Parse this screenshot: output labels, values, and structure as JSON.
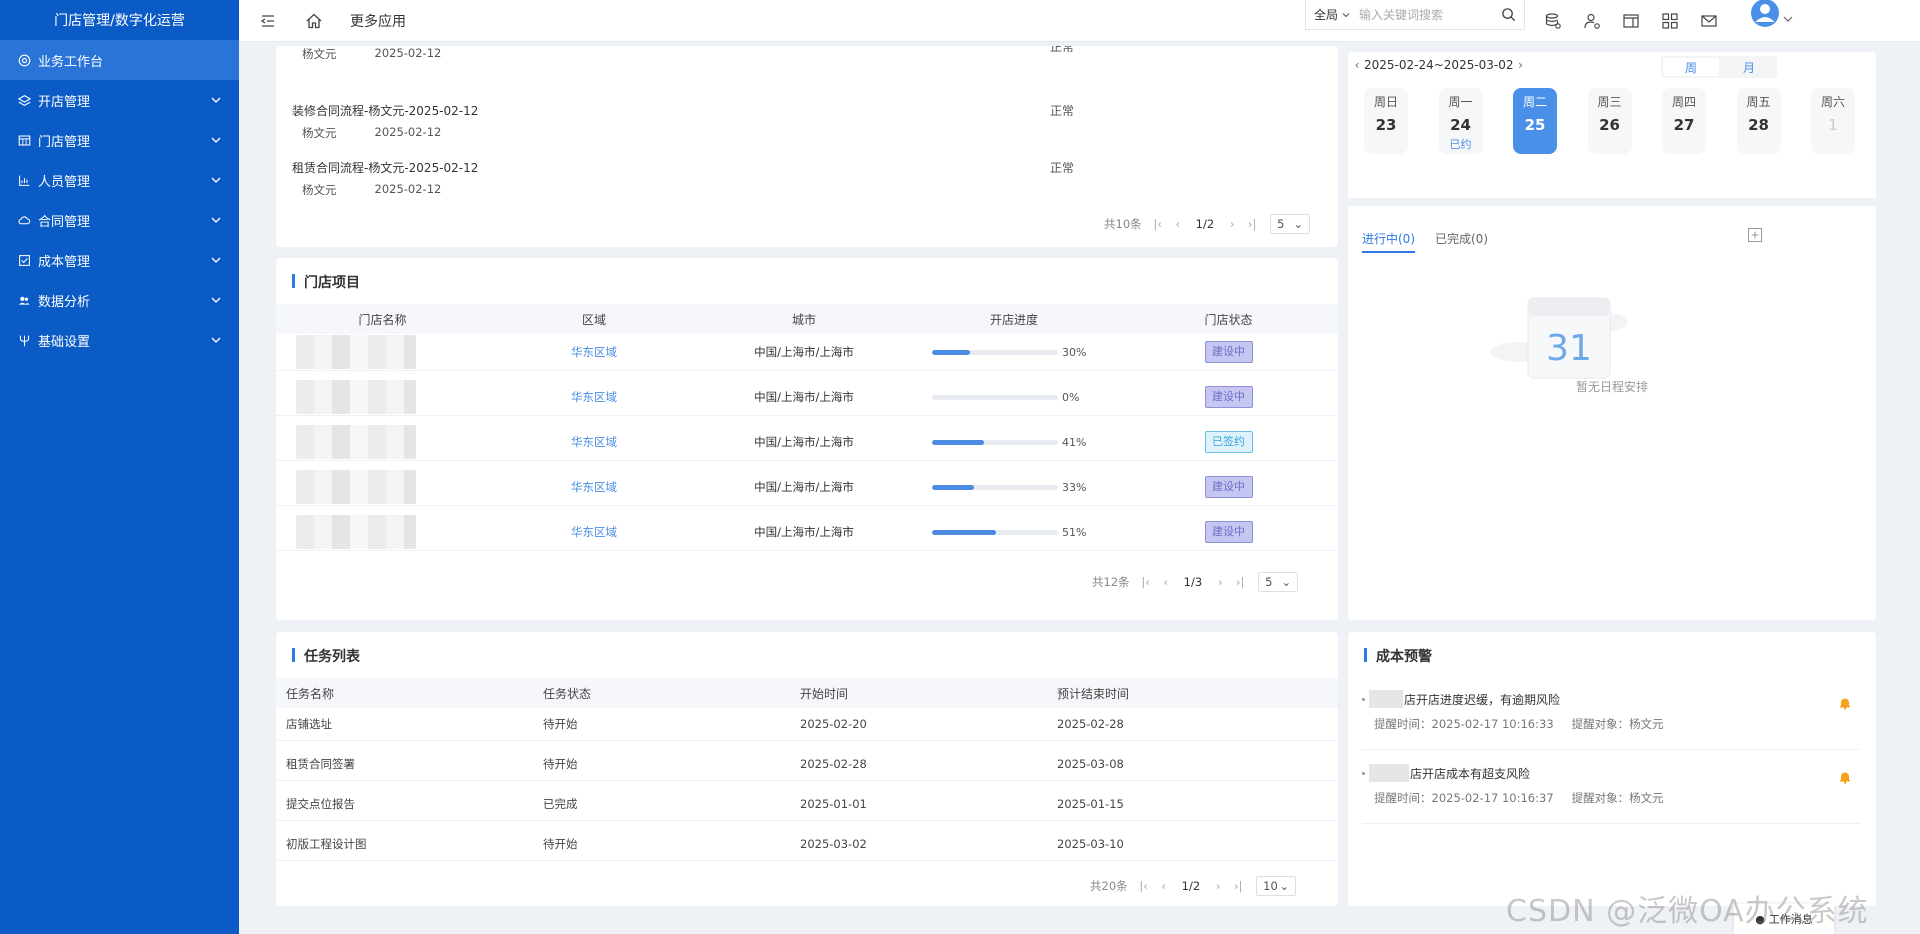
{
  "sidebar": {
    "brand": "门店管理/数字化运营",
    "items": [
      {
        "label": "业务工作台",
        "icon": "at-icon"
      },
      {
        "label": "开店管理",
        "icon": "layers-icon"
      },
      {
        "label": "门店管理",
        "icon": "table-icon"
      },
      {
        "label": "人员管理",
        "icon": "bar-chart-icon"
      },
      {
        "label": "合同管理",
        "icon": "cloud-icon"
      },
      {
        "label": "成本管理",
        "icon": "checkbox-icon"
      },
      {
        "label": "数据分析",
        "icon": "users-icon"
      },
      {
        "label": "基础设置",
        "icon": "fork-icon"
      }
    ]
  },
  "topbar": {
    "more_apps": "更多应用",
    "search_scope": "全局",
    "search_placeholder": "输入关键词搜索"
  },
  "processes": {
    "items": [
      {
        "title": "装修合同流程-杨文元-2025-02-12",
        "person": "杨文元",
        "date": "2025-02-12",
        "status": "正常"
      },
      {
        "title": "租赁合同流程-杨文元-2025-02-12",
        "person": "杨文元",
        "date": "2025-02-12",
        "status": "正常"
      }
    ],
    "partial_person": "杨文元",
    "partial_date": "2025-02-12",
    "partial_status": "正常",
    "total": "共10条",
    "page": "1/2",
    "size": "5"
  },
  "stores": {
    "title": "门店项目",
    "headers": [
      "门店名称",
      "区域",
      "城市",
      "开店进度",
      "门店状态"
    ],
    "rows": [
      {
        "region": "华东区域",
        "city": "中国/上海市/上海市",
        "progress": 30,
        "progress_text": "30%",
        "status": "建设中",
        "status_type": "building"
      },
      {
        "region": "华东区域",
        "city": "中国/上海市/上海市",
        "progress": 0,
        "progress_text": "0%",
        "status": "建设中",
        "status_type": "building"
      },
      {
        "region": "华东区域",
        "city": "中国/上海市/上海市",
        "progress": 41,
        "progress_text": "41%",
        "status": "已签约",
        "status_type": "signed"
      },
      {
        "region": "华东区域",
        "city": "中国/上海市/上海市",
        "progress": 33,
        "progress_text": "33%",
        "status": "建设中",
        "status_type": "building"
      },
      {
        "region": "华东区域",
        "city": "中国/上海市/上海市",
        "progress": 51,
        "progress_text": "51%",
        "status": "建设中",
        "status_type": "building"
      }
    ],
    "total": "共12条",
    "page": "1/3",
    "size": "5"
  },
  "tasks": {
    "title": "任务列表",
    "headers": [
      "任务名称",
      "任务状态",
      "开始时间",
      "预计结束时间"
    ],
    "rows": [
      {
        "name": "店铺选址",
        "status": "待开始",
        "start": "2025-02-20",
        "end": "2025-02-28"
      },
      {
        "name": "租赁合同签署",
        "status": "待开始",
        "start": "2025-02-28",
        "end": "2025-03-08"
      },
      {
        "name": "提交点位报告",
        "status": "已完成",
        "start": "2025-01-01",
        "end": "2025-01-15"
      },
      {
        "name": "初版工程设计图",
        "status": "待开始",
        "start": "2025-03-02",
        "end": "2025-03-10"
      }
    ],
    "total": "共20条",
    "page": "1/2",
    "size": "10"
  },
  "calendar": {
    "range": "2025-02-24~2025-03-02",
    "view_week": "周",
    "view_month": "月",
    "days": [
      {
        "name": "周日",
        "date": "23",
        "extra": ""
      },
      {
        "name": "周一",
        "date": "24",
        "extra": "已约"
      },
      {
        "name": "周二",
        "date": "25",
        "extra": ""
      },
      {
        "name": "周三",
        "date": "26",
        "extra": ""
      },
      {
        "name": "周四",
        "date": "27",
        "extra": ""
      },
      {
        "name": "周五",
        "date": "28",
        "extra": ""
      },
      {
        "name": "周六",
        "date": "1",
        "extra": ""
      }
    ],
    "tab_ongoing": "进行中(0)",
    "tab_done": "已完成(0)",
    "empty_icon_num": "31",
    "empty_text": "暂无日程安排"
  },
  "cost_alert": {
    "title": "成本预警",
    "items": [
      {
        "text": "店开店进度迟缓，有逾期风险",
        "time": "提醒时间：2025-02-17 10:16:33",
        "target": "提醒对象：杨文元"
      },
      {
        "text": "店开店成本有超支风险",
        "time": "提醒时间：2025-02-17 10:16:37",
        "target": "提醒对象：杨文元"
      }
    ]
  },
  "watermark": "CSDN @泛微OA办公系统",
  "work_msg": "工作消息",
  "colors": {
    "sidebar": "#0b5bc6",
    "accent": "#2f79e3",
    "progress": "#4c8be2",
    "selected_day": "#4b90e8"
  }
}
